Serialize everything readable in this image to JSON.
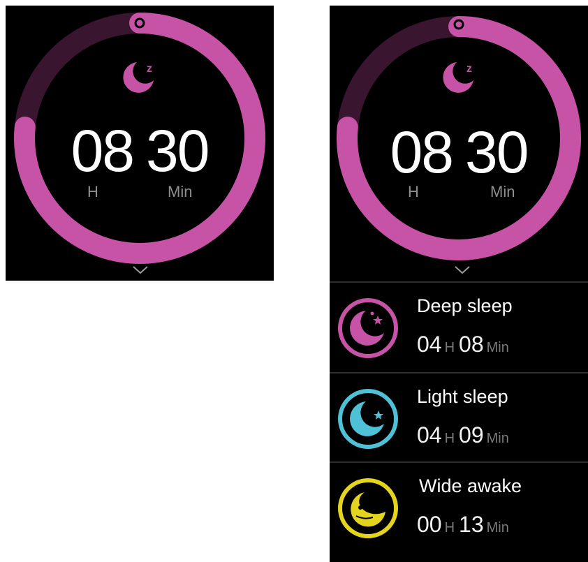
{
  "colors": {
    "accent": "#c653a5",
    "ring_track": "#3a1530",
    "light_sleep": "#4fc1d6",
    "awake": "#e4d41e",
    "background": "#000000"
  },
  "sleep_summary": {
    "hours": "08",
    "minutes": "30",
    "hours_unit": "H",
    "minutes_unit": "Min",
    "progress_fraction": 0.82
  },
  "stats": [
    {
      "title": "Deep sleep",
      "hours": "04",
      "hours_unit": "H",
      "minutes": "08",
      "minutes_unit": "Min",
      "icon": "moon-stars-icon"
    },
    {
      "title": "Light sleep",
      "hours": "04",
      "hours_unit": "H",
      "minutes": "09",
      "minutes_unit": "Min",
      "icon": "moon-star-icon"
    },
    {
      "title": "Wide awake",
      "hours": "00",
      "hours_unit": "H",
      "minutes": "13",
      "minutes_unit": "Min",
      "icon": "moon-icon"
    }
  ]
}
